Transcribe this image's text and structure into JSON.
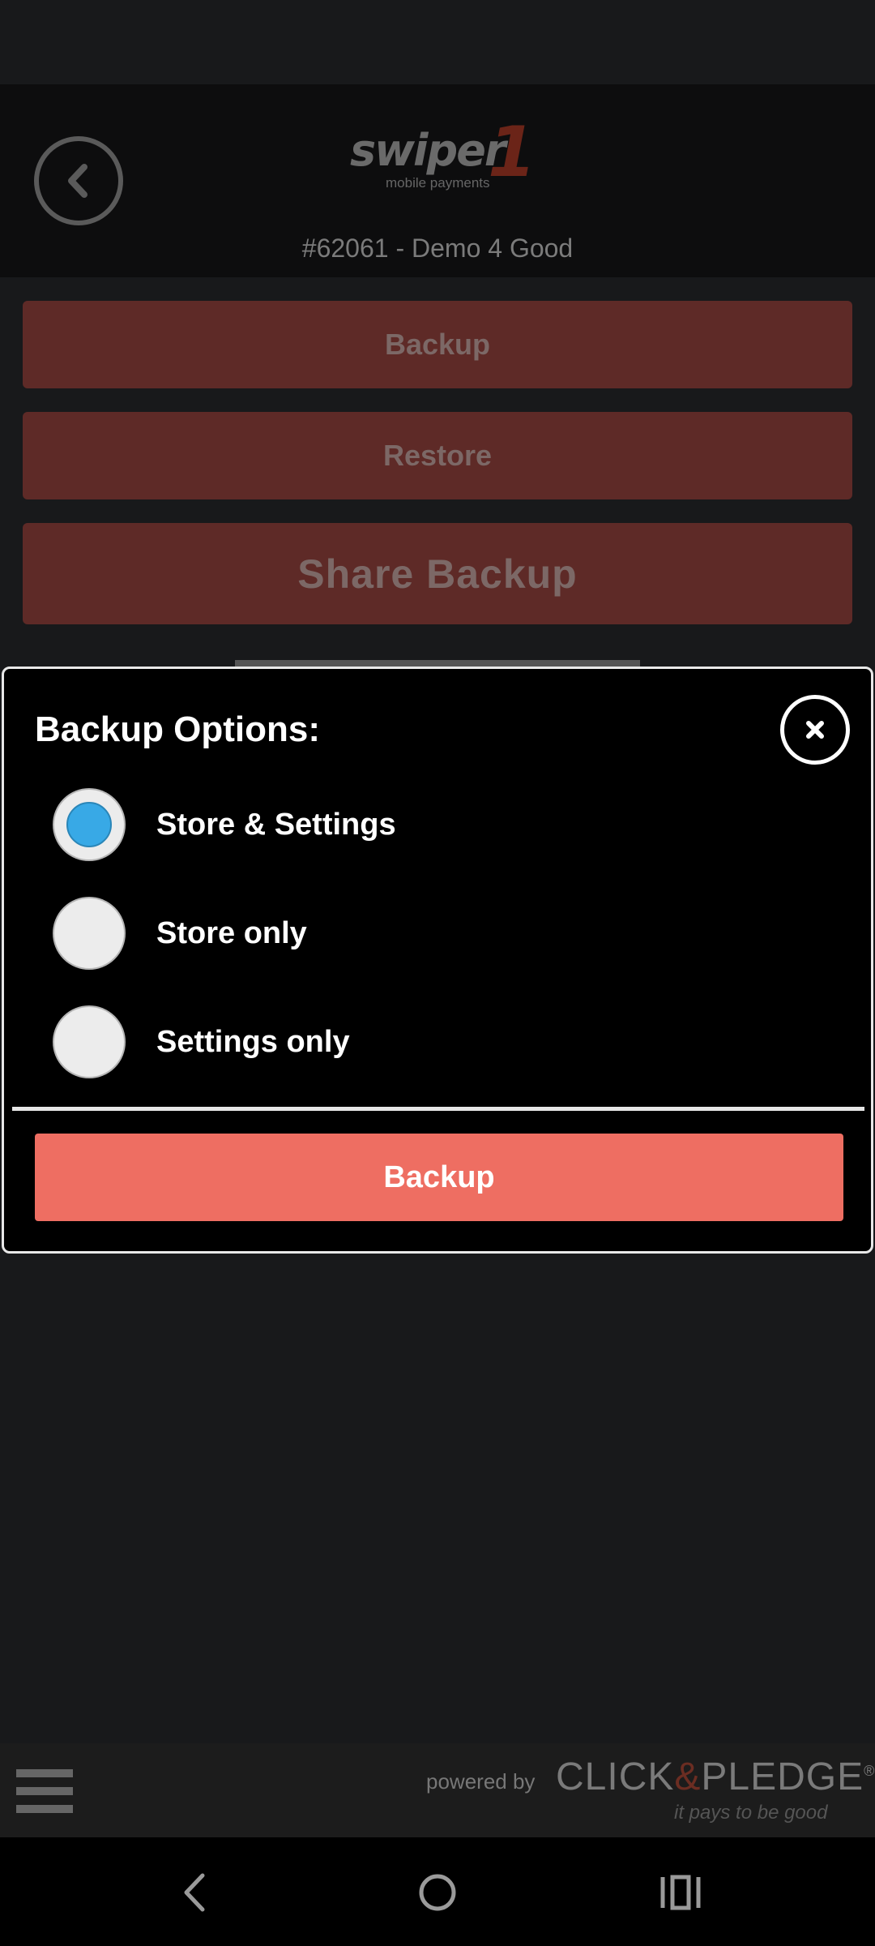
{
  "header": {
    "logo_word": "swiper",
    "logo_numeral": "1",
    "logo_subtitle": "mobile payments",
    "account_label": "#62061 - Demo 4 Good"
  },
  "background_buttons": {
    "backup": "Backup",
    "restore": "Restore",
    "share_backup": "Share Backup"
  },
  "modal": {
    "title": "Backup Options:",
    "options": [
      {
        "label": "Store & Settings",
        "selected": true
      },
      {
        "label": "Store only",
        "selected": false
      },
      {
        "label": "Settings only",
        "selected": false
      }
    ],
    "confirm_label": "Backup"
  },
  "footer": {
    "powered_by": "powered by",
    "brand_left": "CLICK",
    "brand_amp": "&",
    "brand_right": "PLEDGE",
    "brand_mark": "®",
    "tagline": "it pays to be good"
  },
  "colors": {
    "accent_button": "#ee6e62",
    "radio_selected": "#38a9e6",
    "dimmed_button": "#5e2a27"
  },
  "icons": {
    "back": "chevron-left-circle-icon",
    "close": "close-circle-icon",
    "menu": "hamburger-icon",
    "nav_back": "chevron-left-icon",
    "nav_home": "circle-home-icon",
    "nav_recents": "recents-icon"
  }
}
